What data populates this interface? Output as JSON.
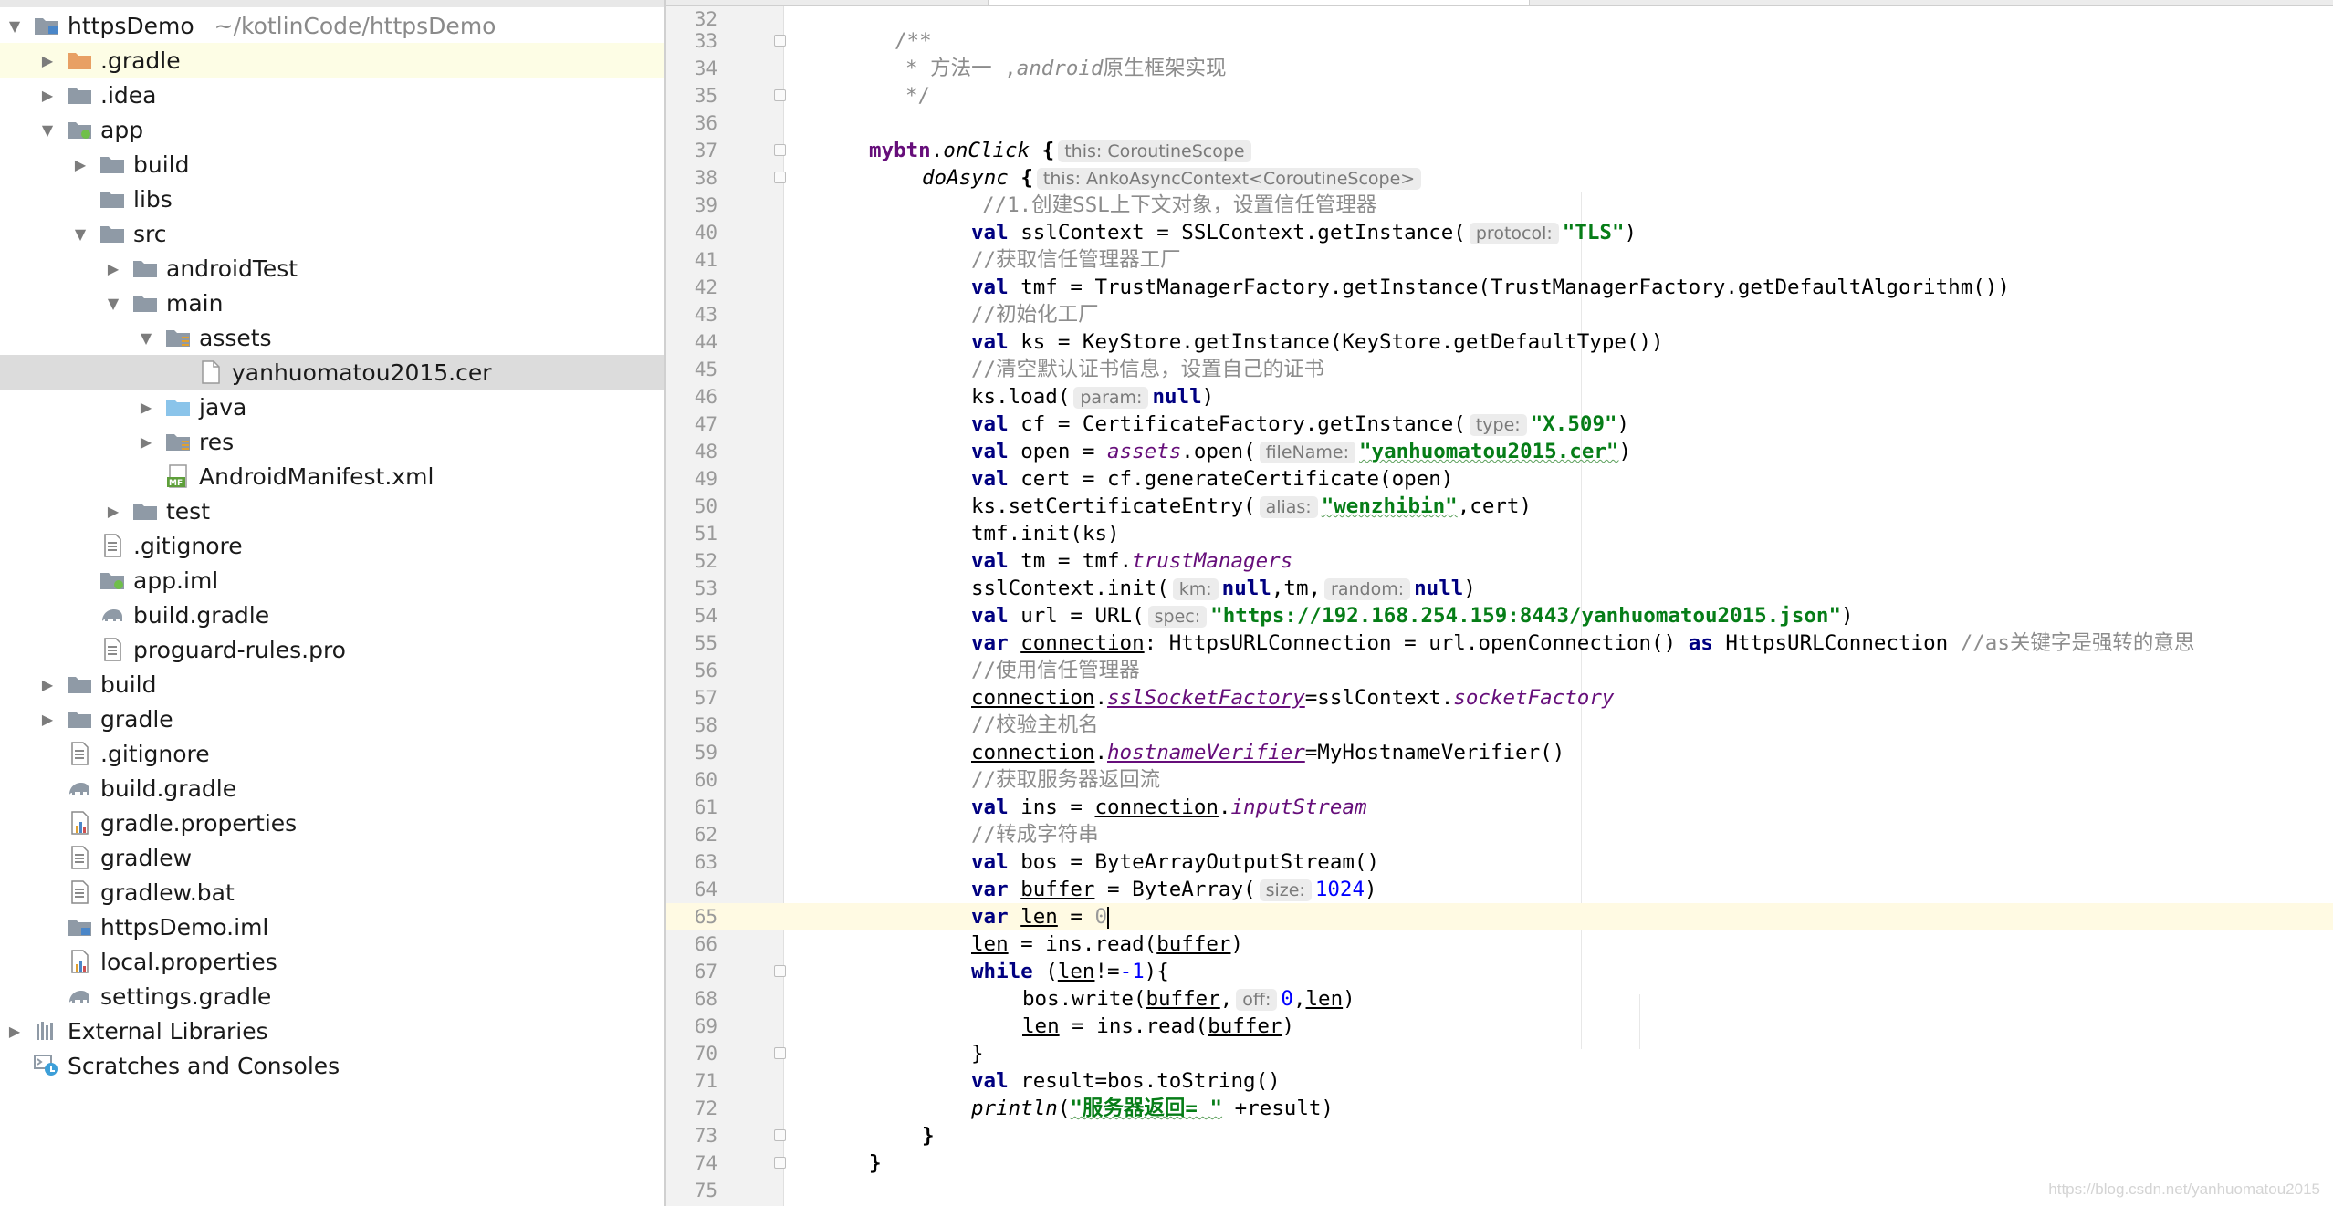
{
  "project_tree": {
    "root": {
      "name": "httpsDemo",
      "path": "~/kotlinCode/httpsDemo"
    },
    "items": [
      {
        "label": ".gradle"
      },
      {
        "label": ".idea"
      },
      {
        "label": "app"
      },
      {
        "label": "build"
      },
      {
        "label": "libs"
      },
      {
        "label": "src"
      },
      {
        "label": "androidTest"
      },
      {
        "label": "main"
      },
      {
        "label": "assets"
      },
      {
        "label": "yanhuomatou2015.cer"
      },
      {
        "label": "java"
      },
      {
        "label": "res"
      },
      {
        "label": "AndroidManifest.xml"
      },
      {
        "label": "test"
      },
      {
        "label": ".gitignore"
      },
      {
        "label": "app.iml"
      },
      {
        "label": "build.gradle"
      },
      {
        "label": "proguard-rules.pro"
      },
      {
        "label": "build"
      },
      {
        "label": "gradle"
      },
      {
        "label": ".gitignore"
      },
      {
        "label": "build.gradle"
      },
      {
        "label": "gradle.properties"
      },
      {
        "label": "gradlew"
      },
      {
        "label": "gradlew.bat"
      },
      {
        "label": "httpsDemo.iml"
      },
      {
        "label": "local.properties"
      },
      {
        "label": "settings.gradle"
      },
      {
        "label": "External Libraries"
      },
      {
        "label": "Scratches and Consoles"
      }
    ]
  },
  "editor": {
    "current_line": "65",
    "lines": [
      {
        "n": "32"
      },
      {
        "n": "33"
      },
      {
        "n": "34"
      },
      {
        "n": "35"
      },
      {
        "n": "36"
      },
      {
        "n": "37"
      },
      {
        "n": "38"
      },
      {
        "n": "39"
      },
      {
        "n": "40"
      },
      {
        "n": "41"
      },
      {
        "n": "42"
      },
      {
        "n": "43"
      },
      {
        "n": "44"
      },
      {
        "n": "45"
      },
      {
        "n": "46"
      },
      {
        "n": "47"
      },
      {
        "n": "48"
      },
      {
        "n": "49"
      },
      {
        "n": "50"
      },
      {
        "n": "51"
      },
      {
        "n": "52"
      },
      {
        "n": "53"
      },
      {
        "n": "54"
      },
      {
        "n": "55"
      },
      {
        "n": "56"
      },
      {
        "n": "57"
      },
      {
        "n": "58"
      },
      {
        "n": "59"
      },
      {
        "n": "60"
      },
      {
        "n": "61"
      },
      {
        "n": "62"
      },
      {
        "n": "63"
      },
      {
        "n": "64"
      },
      {
        "n": "65"
      },
      {
        "n": "66"
      },
      {
        "n": "67"
      },
      {
        "n": "68"
      },
      {
        "n": "69"
      },
      {
        "n": "70"
      },
      {
        "n": "71"
      },
      {
        "n": "72"
      },
      {
        "n": "73"
      },
      {
        "n": "74"
      },
      {
        "n": "75"
      }
    ],
    "code": {
      "l33": "/**",
      "l34_a": "* 方法一 ,",
      "l34_b": "android",
      "l34_c": "原生框架实现",
      "l35": "*/",
      "l37_obj": "mybtn",
      "l37_fn": "onClick",
      "l37_brace": "{",
      "l37_hint": "this: CoroutineScope",
      "l38_fn": "doAsync",
      "l38_brace": "{",
      "l38_hint": "this: AnkoAsyncContext<CoroutineScope>",
      "l39": "//1.创建SSL上下文对象，设置信任管理器",
      "l40_a": "sslContext = SSLContext.getInstance(",
      "l40_hint": "protocol:",
      "l40_str": "\"TLS\"",
      "l40_b": ")",
      "l41": "//获取信任管理器工厂",
      "l42_a": "tmf = TrustManagerFactory.getInstance(TrustManagerFactory.getDefaultAlgorithm())",
      "l43": "//初始化工厂",
      "l44_a": "ks = KeyStore.getInstance(KeyStore.getDefaultType())",
      "l45": "//清空默认证书信息，设置自己的证书",
      "l46_a": "ks.load(",
      "l46_hint": "param:",
      "l46_null": "null",
      "l46_b": ")",
      "l47_a": "cf = CertificateFactory.getInstance(",
      "l47_hint": "type:",
      "l47_str": "\"X.509\"",
      "l47_b": ")",
      "l48_a": "open = ",
      "l48_prop": "assets",
      "l48_b": ".open(",
      "l48_hint": "fileName:",
      "l48_str": "\"yanhuomatou2015.cer\"",
      "l48_c": ")",
      "l49_a": "cert = cf.generateCertificate(open)",
      "l50_a": "ks.setCertificateEntry(",
      "l50_hint": "alias:",
      "l50_str": "\"wenzhibin\"",
      "l50_b": ",cert)",
      "l51": "tmf.init(ks)",
      "l52_a": "tm = tmf.",
      "l52_prop": "trustManagers",
      "l53_a": "sslContext.init(",
      "l53_hint1": "km:",
      "l53_null1": "null",
      "l53_b": ",tm,",
      "l53_hint2": "random:",
      "l53_null2": "null",
      "l53_c": ")",
      "l54_a": "url = URL(",
      "l54_hint": "spec:",
      "l54_str": "\"https://192.168.254.159:8443/yanhuomatou2015.json\"",
      "l54_b": ")",
      "l55_var": "connection",
      "l55_a": ": HttpsURLConnection = url.openConnection() ",
      "l55_as": "as",
      "l55_b": " HttpsURLConnection ",
      "l55_cmt": "//as关键字是强转的意思",
      "l56": "//使用信任管理器",
      "l57_var": "connection",
      "l57_dot": ".",
      "l57_prop": "sslSocketFactory",
      "l57_a": "=sslContext.",
      "l57_prop2": "socketFactory",
      "l58": "//校验主机名",
      "l59_var": "connection",
      "l59_dot": ".",
      "l59_prop": "hostnameVerifier",
      "l59_a": "=MyHostnameVerifier()",
      "l60": "//获取服务器返回流",
      "l61_a": "ins = ",
      "l61_var": "connection",
      "l61_dot": ".",
      "l61_prop": "inputStream",
      "l62": "//转成字符串",
      "l63_a": "bos = ByteArrayOutputStream()",
      "l64_var": "buffer",
      "l64_a": " = ByteArray(",
      "l64_hint": "size:",
      "l64_num": "1024",
      "l64_b": ")",
      "l65_var": "len",
      "l65_a": " = ",
      "l65_num": "0",
      "l66_var": "len",
      "l66_a": " = ins.read(",
      "l66_var2": "buffer",
      "l66_b": ")",
      "l67_kw": "while",
      "l67_a": " (",
      "l67_var": "len",
      "l67_b": "!=",
      "l67_num": "-1",
      "l67_c": "){",
      "l68_a": "bos.write(",
      "l68_var": "buffer",
      "l68_b": ",",
      "l68_hint": "off:",
      "l68_num": "0",
      "l68_c": ",",
      "l68_var2": "len",
      "l68_d": ")",
      "l69_var": "len",
      "l69_a": " = ins.read(",
      "l69_var2": "buffer",
      "l69_b": ")",
      "l70": "}",
      "l71_a": "result=bos.toString()",
      "l72_fn": "println",
      "l72_a": "(",
      "l72_str": "\"服务器返回= \"",
      "l72_b": " +result)",
      "l73": "}",
      "l74": "}",
      "kw_val": "val",
      "kw_var": "var",
      "kw_null": "null"
    }
  },
  "watermark": "https://blog.csdn.net/yanhuomatou2015"
}
